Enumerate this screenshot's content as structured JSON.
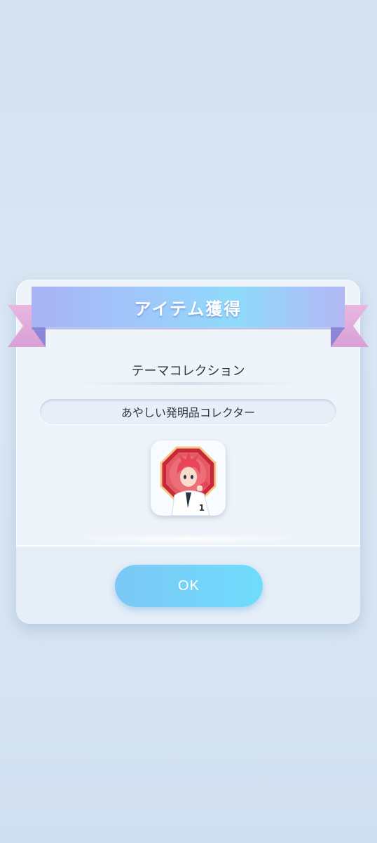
{
  "dialog": {
    "title": "アイテム獲得",
    "category": "テーマコレクション",
    "item_name": "あやしい発明品コレクター",
    "item": {
      "icon": "character-badge-icon",
      "count": "1"
    },
    "ok_label": "OK"
  },
  "colors": {
    "background": "#d8e6f3",
    "ribbon": "#9fc7fb",
    "ribbon_tail": "#d9a0d6",
    "ok_button": "#6fdcfc",
    "text": "#2f3542"
  }
}
